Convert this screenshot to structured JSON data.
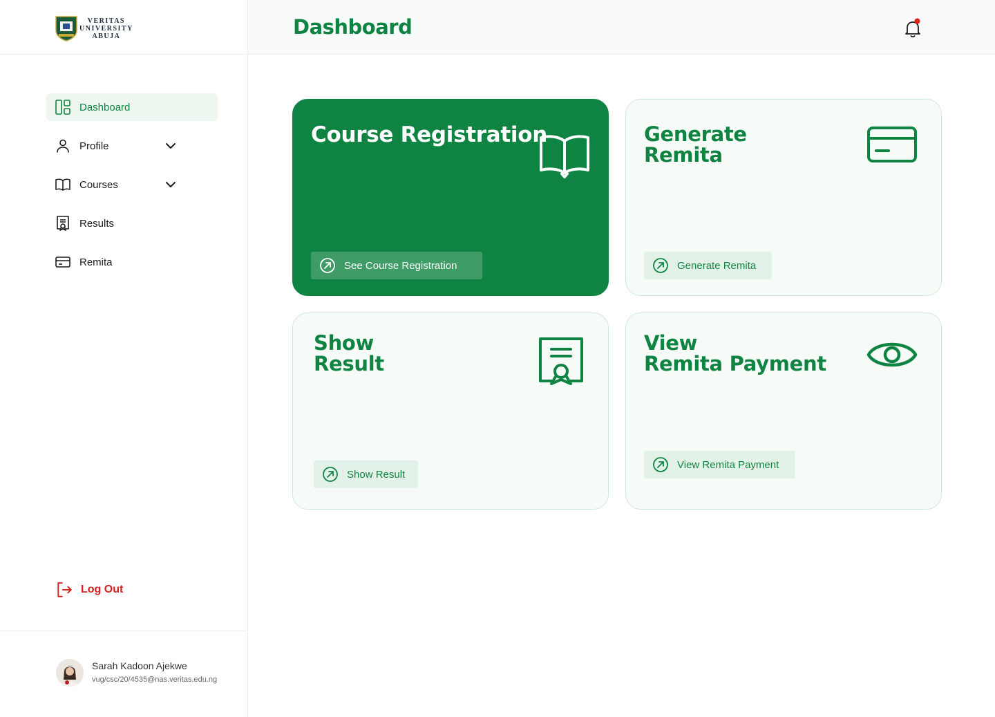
{
  "logo": {
    "line1": "VERITAS",
    "line2": "UNIVERSITY",
    "line3": "ABUJA"
  },
  "sidebar": {
    "items": [
      {
        "label": "Dashboard",
        "icon": "dashboard-icon",
        "active": true
      },
      {
        "label": "Profile",
        "icon": "user-icon",
        "expandable": true
      },
      {
        "label": "Courses",
        "icon": "book-icon",
        "expandable": true
      },
      {
        "label": "Results",
        "icon": "certificate-icon"
      },
      {
        "label": "Remita",
        "icon": "credit-card-icon"
      }
    ],
    "logout_label": "Log Out"
  },
  "user": {
    "name": "Sarah Kadoon Ajekwe",
    "email": "vug/csc/20/4535@nas.veritas.edu.ng"
  },
  "header": {
    "title": "Dashboard",
    "notification_dot": true
  },
  "cards": [
    {
      "title": "Course Registration",
      "button": "See Course Registration",
      "icon": "book-icon"
    },
    {
      "title_line1": "Generate",
      "title_line2": "Remita",
      "button": "Generate Remita",
      "icon": "credit-card-icon"
    },
    {
      "title_line1": "Show",
      "title_line2": "Result",
      "button": "Show Result",
      "icon": "certificate-icon"
    },
    {
      "title_line1": "View",
      "title_line2": "Remita Payment",
      "button": "View Remita Payment",
      "icon": "eye-icon"
    }
  ],
  "colors": {
    "brand": "#0f8442",
    "danger": "#d42020",
    "card_bg": "#f6fbf8",
    "button_bg": "#e3f2e8"
  }
}
